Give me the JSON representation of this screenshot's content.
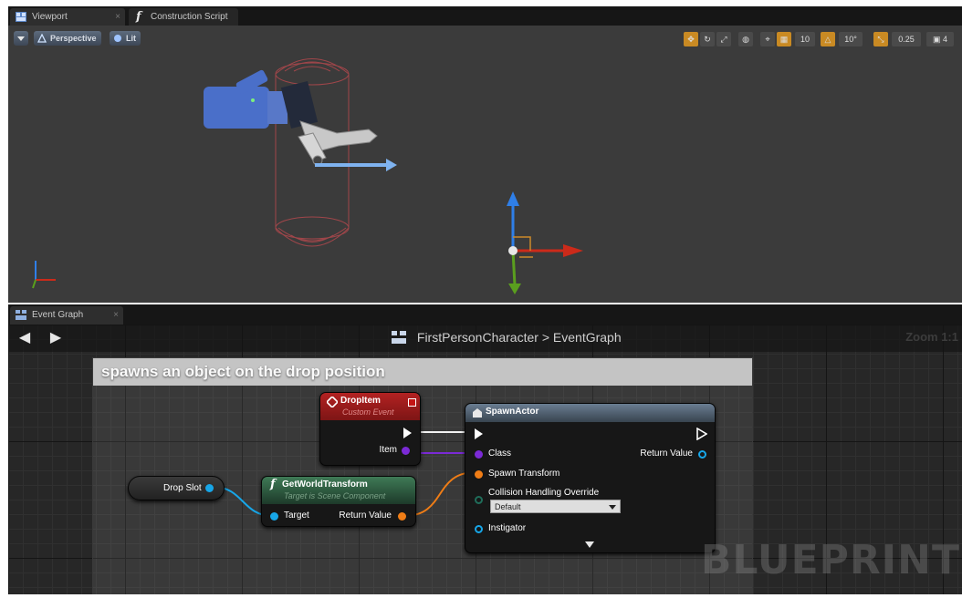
{
  "tabs": {
    "viewport": "Viewport",
    "construction_script": "Construction Script",
    "event_graph": "Event Graph"
  },
  "viewport_toolbar": {
    "perspective": "Perspective",
    "lit": "Lit",
    "grid_snap": "10",
    "rotate_snap": "10°",
    "scale_snap": "0.25",
    "camera_speed": "4"
  },
  "graph": {
    "breadcrumb_root": "FirstPersonCharacter",
    "breadcrumb_sep": ">",
    "breadcrumb_leaf": "EventGraph",
    "zoom": "Zoom 1:1",
    "comment": "spawns an object on the drop position",
    "watermark": "BLUEPRINT"
  },
  "nodes": {
    "drop_item": {
      "title": "DropItem",
      "subtitle": "Custom Event",
      "pin_item": "Item"
    },
    "spawn_actor": {
      "title": "SpawnActor",
      "pin_class": "Class",
      "pin_return": "Return Value",
      "pin_spawn_transform": "Spawn Transform",
      "pin_collision": "Collision Handling Override",
      "collision_value": "Default",
      "pin_instigator": "Instigator"
    },
    "drop_slot": {
      "label": "Drop Slot"
    },
    "get_world_transform": {
      "title": "GetWorldTransform",
      "subtitle": "Target is Scene Component",
      "pin_target": "Target",
      "pin_return": "Return Value"
    }
  },
  "colors": {
    "exec_pin": "#ffffff",
    "class_pin": "#7b2ad6",
    "transform_pin": "#f07d16",
    "object_pin": "#17a6e8",
    "event_header": "#a31d1d",
    "function_header": "#3e6e53",
    "spawn_header": "#4d5d6d"
  },
  "icons": {
    "viewport_tab": "viewport-icon",
    "construction_tab": "function-icon",
    "event_graph_tab": "graph-icon",
    "back": "arrow-left-icon",
    "forward": "arrow-right-icon"
  }
}
